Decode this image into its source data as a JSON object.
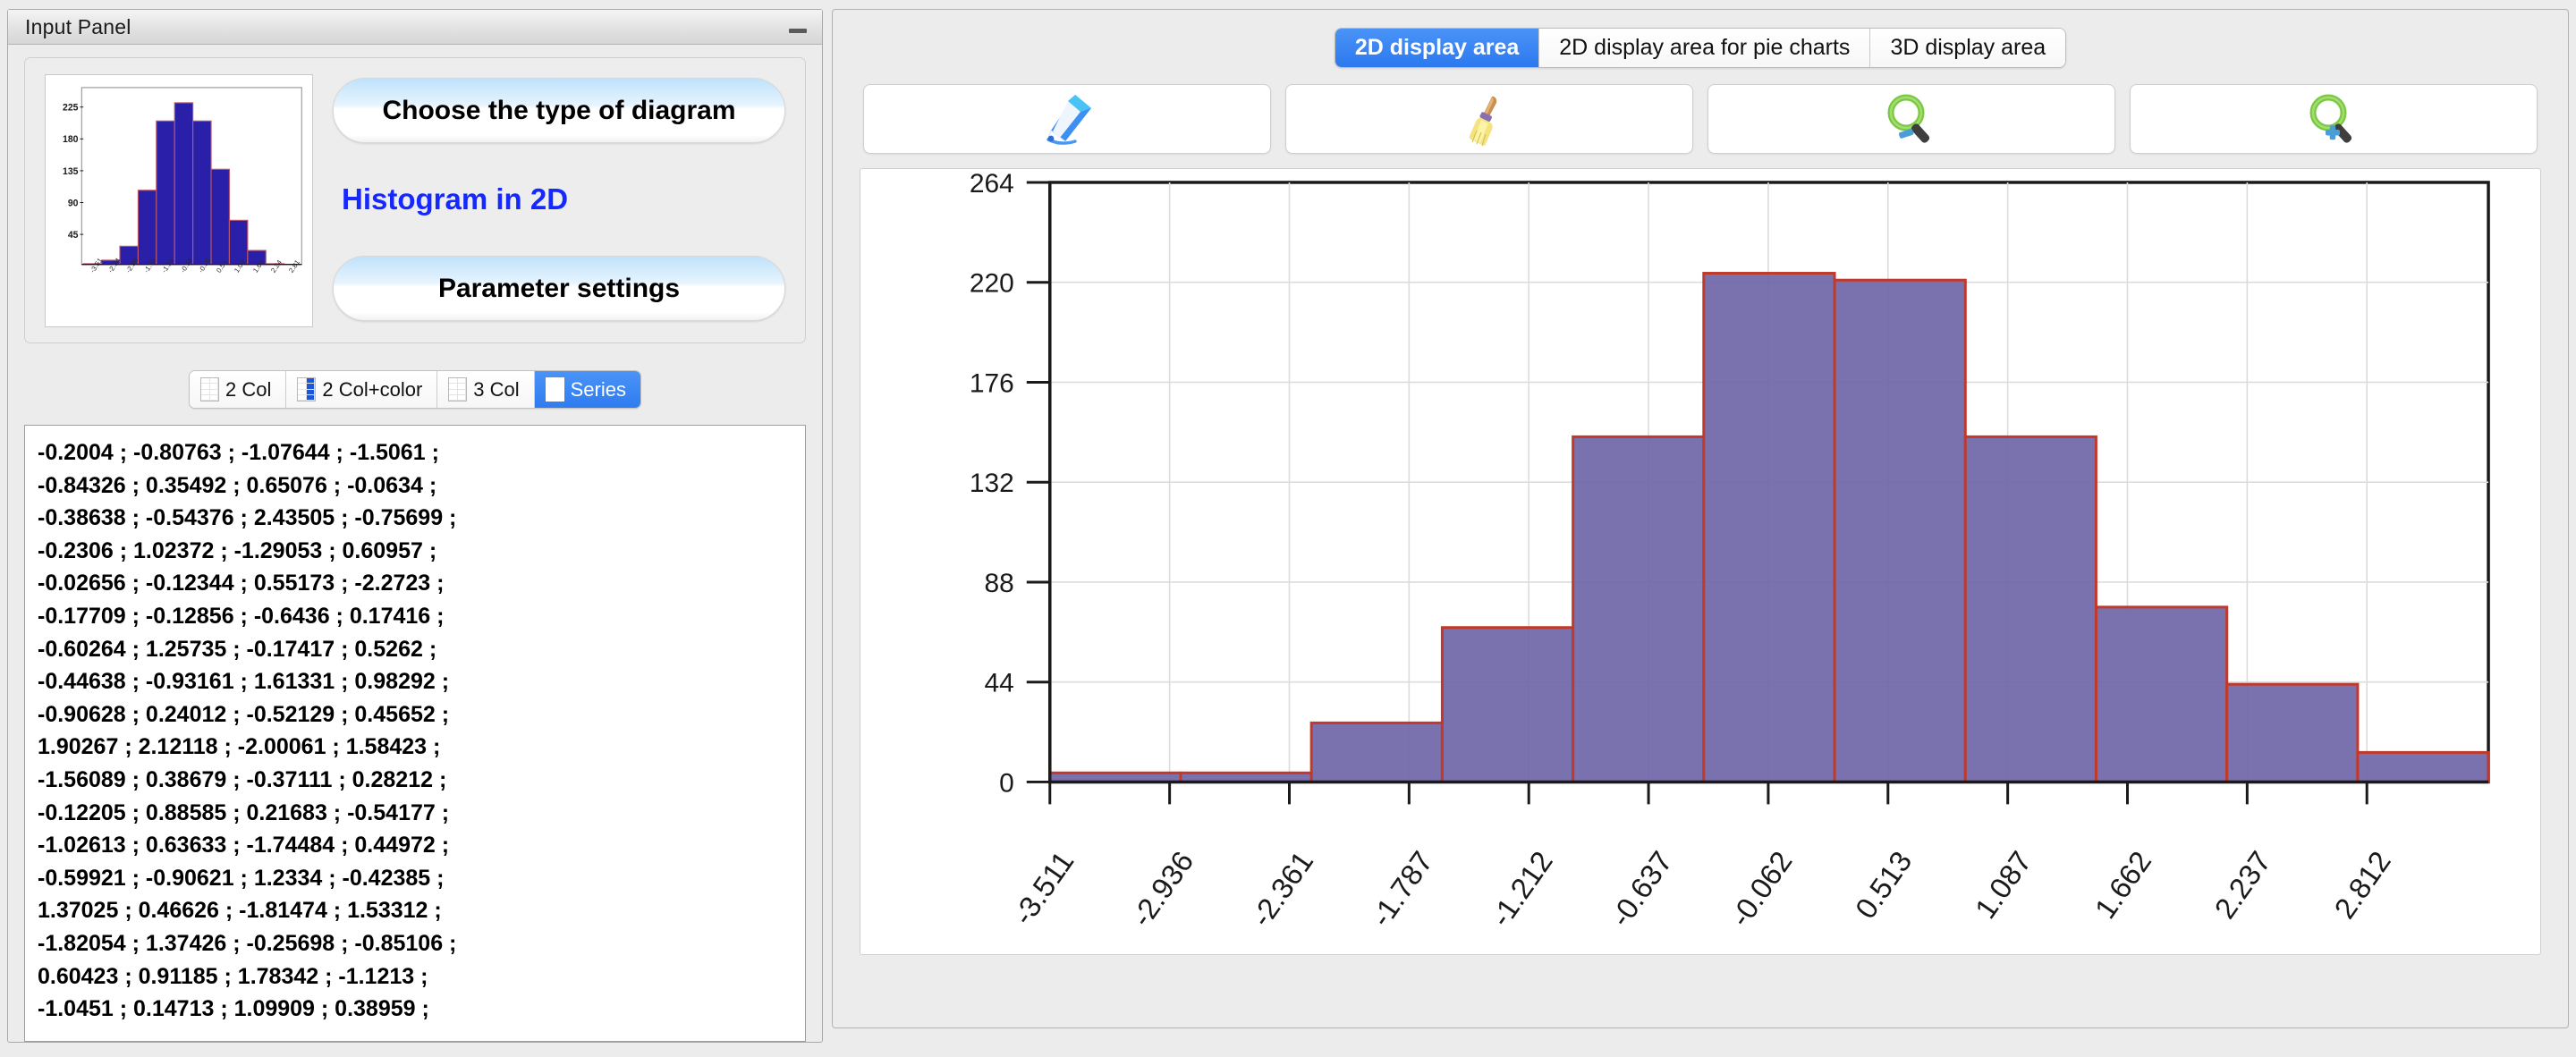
{
  "input_panel": {
    "title": "Input Panel",
    "minimize_icon": "minimize-icon",
    "choose_type_label": "Choose the type of diagram",
    "diagram_kind_label": "Histogram in 2D",
    "parameter_settings_label": "Parameter settings",
    "segmented": [
      {
        "label": "2 Col",
        "icon": "table-2col-icon",
        "active": false
      },
      {
        "label": "2 Col+color",
        "icon": "table-2colcolor-icon",
        "active": true
      },
      {
        "label": "3 Col",
        "icon": "table-3col-icon",
        "active": false
      },
      {
        "label": "Series",
        "icon": "table-series-icon",
        "active": true
      }
    ],
    "data_lines": [
      "-0.2004 ; -0.80763 ; -1.07644 ; -1.5061 ;",
      "-0.84326 ; 0.35492 ; 0.65076 ; -0.0634 ;",
      "-0.38638 ; -0.54376 ; 2.43505 ; -0.75699 ;",
      "-0.2306 ; 1.02372 ; -1.29053 ; 0.60957 ;",
      "-0.02656 ; -0.12344 ; 0.55173 ; -2.2723 ;",
      "-0.17709 ; -0.12856 ; -0.6436 ; 0.17416 ;",
      "-0.60264 ; 1.25735 ; -0.17417 ; 0.5262 ;",
      "-0.44638 ; -0.93161 ; 1.61331 ; 0.98292 ;",
      "-0.90628 ; 0.24012 ; -0.52129 ; 0.45652 ;",
      "1.90267 ; 2.12118 ; -2.00061 ; 1.58423 ;",
      "-1.56089 ; 0.38679 ; -0.37111 ; 0.28212 ;",
      "-0.12205 ; 0.88585 ; 0.21683 ; -0.54177 ;",
      "-1.02613 ; 0.63633 ; -1.74484 ; 0.44972 ;",
      "-0.59921 ; -0.90621 ; 1.2334 ; -0.42385 ;",
      "1.37025 ; 0.46626 ; -1.81474 ; 1.53312 ;",
      "-1.82054 ; 1.37426 ; -0.25698 ; -0.85106 ;",
      "0.60423 ; 0.91185 ; 1.78342 ; -1.1213 ;",
      "-1.0451 ; 0.14713 ; 1.09909 ; 0.38959 ;"
    ]
  },
  "display_panel": {
    "tabs": [
      {
        "label": "2D display area",
        "active": true
      },
      {
        "label": "2D display area for pie charts",
        "active": false
      },
      {
        "label": "3D display area",
        "active": false
      }
    ],
    "toolbar": [
      {
        "icon": "pen-icon",
        "name": "draw-button"
      },
      {
        "icon": "broom-icon",
        "name": "clear-button"
      },
      {
        "icon": "zoom-out-icon",
        "name": "zoom-out-button"
      },
      {
        "icon": "zoom-in-icon",
        "name": "zoom-in-button"
      }
    ]
  },
  "colors": {
    "accent": "#2f7cf0",
    "bar_fill": "#6f66a8",
    "bar_stroke": "#c0392b",
    "thumb_bar_fill": "#2a1fa8",
    "thumb_bar_stroke": "#b8556a",
    "diagram_kind": "#1528ff"
  },
  "chart_data": {
    "type": "bar",
    "title": "",
    "xlabel": "",
    "ylabel": "",
    "categories": [
      "-3.511",
      "-2.936",
      "-2.361",
      "-1.787",
      "-1.212",
      "-0.637",
      "-0.062",
      "0.513",
      "1.087",
      "1.662",
      "2.237",
      "2.812"
    ],
    "bin_edges": [
      -3.511,
      -2.936,
      -2.361,
      -1.787,
      -1.212,
      -0.637,
      -0.062,
      0.513,
      1.087,
      1.662,
      2.237,
      2.812
    ],
    "values": [
      4,
      4,
      26,
      68,
      152,
      224,
      221,
      152,
      77,
      43,
      13
    ],
    "yticks": [
      0,
      44,
      88,
      132,
      176,
      220,
      264
    ],
    "ylim": [
      0,
      264
    ],
    "grid": true,
    "legend": "none",
    "xtick_rotation": -55
  },
  "thumbnail_chart": {
    "type": "bar",
    "yticks": [
      45,
      90,
      135,
      180,
      225
    ],
    "ylim": [
      0,
      250
    ],
    "values": [
      1,
      6,
      26,
      106,
      205,
      231,
      205,
      136,
      63,
      20,
      1
    ],
    "grid": false
  }
}
